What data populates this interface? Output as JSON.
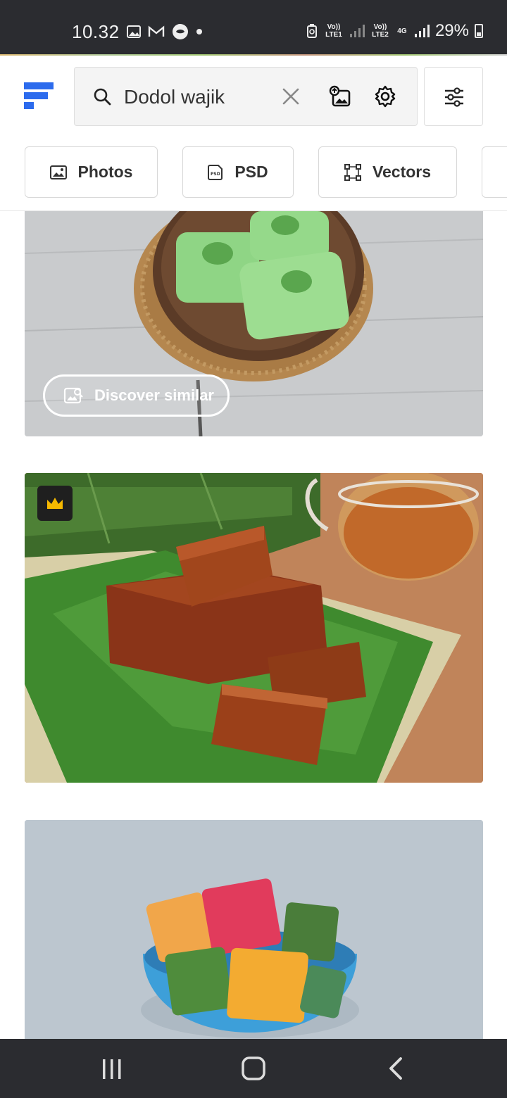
{
  "status_bar": {
    "time": "10.32",
    "sim1_label": "Vo)) LTE1",
    "sim2_label": "Vo)) LTE2",
    "network_type": "4G",
    "battery": "29%"
  },
  "search": {
    "query": "Dodol wajik",
    "placeholder": ""
  },
  "categories": [
    {
      "label": "Photos",
      "icon": "image-icon"
    },
    {
      "label": "PSD",
      "icon": "psd-icon"
    },
    {
      "label": "Vectors",
      "icon": "vector-icon"
    }
  ],
  "results": [
    {
      "description": "Green steamed cakes in wooden bowl",
      "action_label": "Discover similar"
    },
    {
      "description": "Wajik sticky rice cakes on banana leaf with tea",
      "premium": true
    },
    {
      "description": "Colorful dodol cubes in blue bowl"
    }
  ],
  "colors": {
    "status_bar_bg": "#2b2c30",
    "brand_blue": "#2c6bed",
    "premium_gold": "#f5b800"
  }
}
